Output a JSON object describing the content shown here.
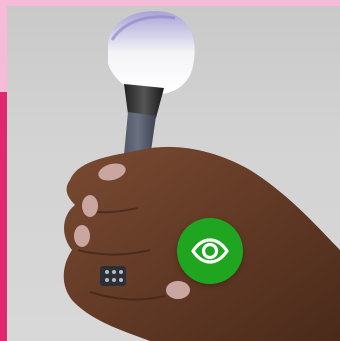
{
  "image": {
    "subject": "hand-holding-makeup-brush"
  },
  "overlay": {
    "view_button": {
      "icon": "eye-icon",
      "color": "#1fa51f"
    }
  },
  "colors": {
    "accent_pink": "#e0286e",
    "accent_light_pink": "#f6bcd7",
    "background_gray": "#d3d3d3"
  }
}
